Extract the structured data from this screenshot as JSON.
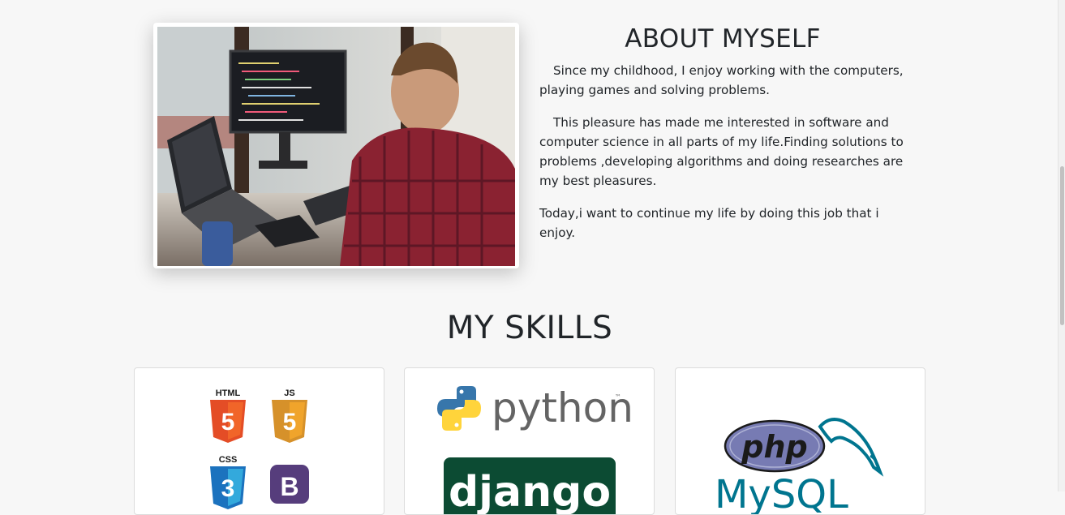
{
  "about": {
    "title": "ABOUT MYSELF",
    "photo_icon": "developer-at-desk-photo",
    "paragraphs": [
      "Since my childhood, I enjoy working with the computers, playing games and solving problems.",
      "This pleasure has made me interested in software and computer science in all parts of my life.Finding solutions to problems ,developing algorithms and doing researches are my best pleasures.",
      "Today,i want to continue my life by doing this job that i enjoy."
    ]
  },
  "skills": {
    "title": "MY SKILLS",
    "cards": [
      {
        "icon": "html-js-css-bootstrap-logos",
        "logo_labels": [
          "HTML",
          "JS",
          "CSS"
        ],
        "badge_digits": [
          "5",
          "5",
          "3"
        ],
        "bootstrap_letter": "B"
      },
      {
        "icon": "python-django-logos",
        "python_word": "python",
        "tm": "™",
        "django_word": "django"
      },
      {
        "icon": "php-mysql-logos",
        "php_word": "php",
        "mysql_word": "MySQL"
      }
    ]
  },
  "colors": {
    "html_orange": "#e44d26",
    "js_yellow": "#f0a42b",
    "css_blue": "#1b72be",
    "bootstrap_purple": "#563d7c",
    "python_blue": "#3776ab",
    "python_yellow": "#ffd43b",
    "django_green": "#0c4b33",
    "php_purple": "#777bb3",
    "mysql_blue": "#00758f",
    "mysql_orange": "#f29111"
  }
}
